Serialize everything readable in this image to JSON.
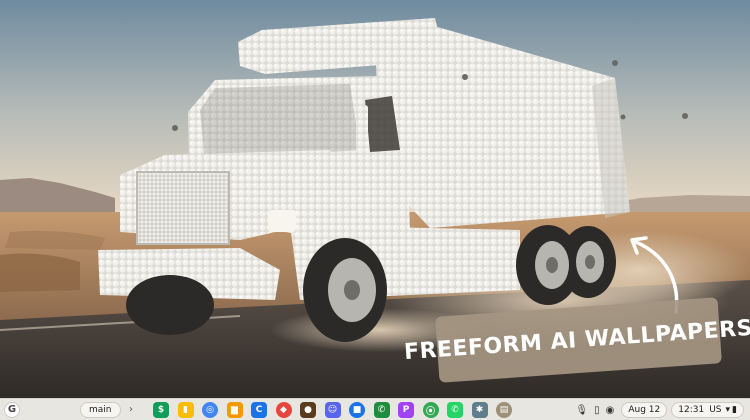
{
  "wallpaper": {
    "caption": "FREEFORM AI WALLPAPERS",
    "colors": {
      "sky_top": "#6f8ba0",
      "sky_bottom": "#e9d9c2",
      "ground": "#b08a66",
      "road": "#3f3a35",
      "truck": "#ecebe6",
      "caption_bg": "#a5967f"
    }
  },
  "shelf": {
    "launcher_icon": "launcher-icon",
    "desk_label": "main",
    "desk_arrow": "›",
    "apps": [
      {
        "name": "sheets-app-icon",
        "color": "#0f9d58",
        "glyph": "$"
      },
      {
        "name": "keep-app-icon",
        "color": "#fbbc04",
        "glyph": "▮"
      },
      {
        "name": "chrome-app-icon",
        "color": "#4285f4",
        "glyph": "◎"
      },
      {
        "name": "analytics-app-icon",
        "color": "#f29900",
        "glyph": "▆"
      },
      {
        "name": "calendar-app-icon",
        "color": "#1a73e8",
        "glyph": "C"
      },
      {
        "name": "slides-app-icon",
        "color": "#e8453c",
        "glyph": "◆"
      },
      {
        "name": "game-app-icon",
        "color": "#5a3b1e",
        "glyph": "●"
      },
      {
        "name": "discord-app-icon",
        "color": "#5865f2",
        "glyph": "☺"
      },
      {
        "name": "messages-app-icon",
        "color": "#1a73e8",
        "glyph": "■"
      },
      {
        "name": "phone-app-icon",
        "color": "#1e8e3e",
        "glyph": "✆"
      },
      {
        "name": "podcast-app-icon",
        "color": "#a142f4",
        "glyph": "P"
      },
      {
        "name": "maps-app-icon",
        "color": "#34a853",
        "glyph": "⦿"
      },
      {
        "name": "whatsapp-app-icon",
        "color": "#25d366",
        "glyph": "✆"
      },
      {
        "name": "photos-app-icon",
        "color": "#607d8b",
        "glyph": "✱"
      },
      {
        "name": "wallpaper-app-icon",
        "color": "#9e8f78",
        "glyph": "▤"
      }
    ],
    "tray": {
      "mic_icon": "microphone-icon",
      "phone_icon": "phone-hub-icon",
      "vpn_icon": "vpn-icon",
      "date": "Aug 12",
      "time": "12:31",
      "locale": "US",
      "wifi_icon": "wifi-icon",
      "battery_icon": "battery-icon"
    }
  }
}
